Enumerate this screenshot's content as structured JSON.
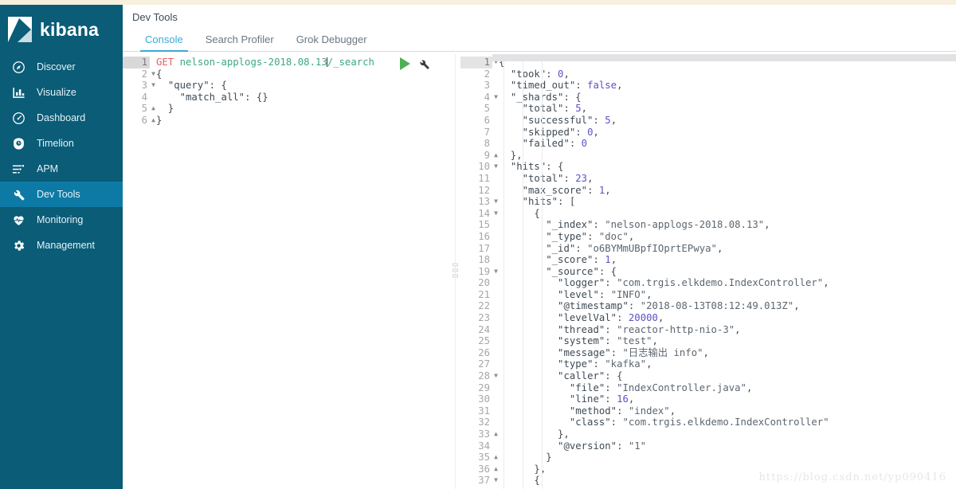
{
  "brand": {
    "name": "kibana"
  },
  "sidebar": {
    "items": [
      {
        "label": "Discover",
        "icon": "compass-icon",
        "active": false
      },
      {
        "label": "Visualize",
        "icon": "bar-chart-icon",
        "active": false
      },
      {
        "label": "Dashboard",
        "icon": "gauge-icon",
        "active": false
      },
      {
        "label": "Timelion",
        "icon": "clock-badge-icon",
        "active": false
      },
      {
        "label": "APM",
        "icon": "apm-lines-icon",
        "active": false
      },
      {
        "label": "Dev Tools",
        "icon": "wrench-icon",
        "active": true
      },
      {
        "label": "Monitoring",
        "icon": "heartbeat-icon",
        "active": false
      },
      {
        "label": "Management",
        "icon": "gear-icon",
        "active": false
      }
    ]
  },
  "header": {
    "title": "Dev Tools"
  },
  "tabs": [
    {
      "label": "Console",
      "active": true
    },
    {
      "label": "Search Profiler",
      "active": false
    },
    {
      "label": "Grok Debugger",
      "active": false
    }
  ],
  "actions": {
    "play_title": "Click to send request",
    "wrench_title": "Open documentation"
  },
  "request": {
    "method": "GET",
    "path": "nelson-applogs-2018.08.13",
    "endpoint": "/_search",
    "lines": [
      {
        "n": 1,
        "fold": "",
        "current": true,
        "tokens": [
          {
            "t": "method",
            "v": "GET"
          },
          {
            "t": "sp",
            "v": " "
          },
          {
            "t": "url",
            "v": "nelson-applogs-2018.08.13"
          },
          {
            "t": "caret",
            "v": ""
          },
          {
            "t": "url",
            "v": "/_search"
          }
        ]
      },
      {
        "n": 2,
        "fold": "open",
        "current": false,
        "tokens": [
          {
            "t": "punct",
            "v": "{"
          }
        ]
      },
      {
        "n": 3,
        "fold": "open",
        "current": false,
        "tokens": [
          {
            "t": "punct",
            "v": "  "
          },
          {
            "t": "key",
            "v": "\"query\""
          },
          {
            "t": "punct",
            "v": ": {"
          }
        ]
      },
      {
        "n": 4,
        "fold": "",
        "current": false,
        "tokens": [
          {
            "t": "punct",
            "v": "    "
          },
          {
            "t": "key",
            "v": "\"match_all\""
          },
          {
            "t": "punct",
            "v": ": {}"
          }
        ]
      },
      {
        "n": 5,
        "fold": "close",
        "current": false,
        "tokens": [
          {
            "t": "punct",
            "v": "  }"
          }
        ]
      },
      {
        "n": 6,
        "fold": "close",
        "current": false,
        "tokens": [
          {
            "t": "punct",
            "v": "}"
          }
        ]
      }
    ]
  },
  "response": {
    "took": 0,
    "timed_out": false,
    "shards": {
      "total": 5,
      "successful": 5,
      "skipped": 0,
      "failed": 0
    },
    "hits_total": 23,
    "max_score": 1,
    "lines": [
      {
        "n": 1,
        "fold": "open",
        "current": true,
        "tokens": [
          {
            "t": "punct",
            "v": "{"
          }
        ]
      },
      {
        "n": 2,
        "fold": "",
        "current": false,
        "tokens": [
          {
            "t": "punct",
            "v": "  "
          },
          {
            "t": "key",
            "v": "\"took\""
          },
          {
            "t": "punct",
            "v": ": "
          },
          {
            "t": "num",
            "v": "0"
          },
          {
            "t": "punct",
            "v": ","
          }
        ]
      },
      {
        "n": 3,
        "fold": "",
        "current": false,
        "tokens": [
          {
            "t": "punct",
            "v": "  "
          },
          {
            "t": "key",
            "v": "\"timed_out\""
          },
          {
            "t": "punct",
            "v": ": "
          },
          {
            "t": "bool",
            "v": "false"
          },
          {
            "t": "punct",
            "v": ","
          }
        ]
      },
      {
        "n": 4,
        "fold": "open",
        "current": false,
        "tokens": [
          {
            "t": "punct",
            "v": "  "
          },
          {
            "t": "key",
            "v": "\"_shards\""
          },
          {
            "t": "punct",
            "v": ": {"
          }
        ]
      },
      {
        "n": 5,
        "fold": "",
        "current": false,
        "tokens": [
          {
            "t": "punct",
            "v": "    "
          },
          {
            "t": "key",
            "v": "\"total\""
          },
          {
            "t": "punct",
            "v": ": "
          },
          {
            "t": "num",
            "v": "5"
          },
          {
            "t": "punct",
            "v": ","
          }
        ]
      },
      {
        "n": 6,
        "fold": "",
        "current": false,
        "tokens": [
          {
            "t": "punct",
            "v": "    "
          },
          {
            "t": "key",
            "v": "\"successful\""
          },
          {
            "t": "punct",
            "v": ": "
          },
          {
            "t": "num",
            "v": "5"
          },
          {
            "t": "punct",
            "v": ","
          }
        ]
      },
      {
        "n": 7,
        "fold": "",
        "current": false,
        "tokens": [
          {
            "t": "punct",
            "v": "    "
          },
          {
            "t": "key",
            "v": "\"skipped\""
          },
          {
            "t": "punct",
            "v": ": "
          },
          {
            "t": "num",
            "v": "0"
          },
          {
            "t": "punct",
            "v": ","
          }
        ]
      },
      {
        "n": 8,
        "fold": "",
        "current": false,
        "tokens": [
          {
            "t": "punct",
            "v": "    "
          },
          {
            "t": "key",
            "v": "\"failed\""
          },
          {
            "t": "punct",
            "v": ": "
          },
          {
            "t": "num",
            "v": "0"
          }
        ]
      },
      {
        "n": 9,
        "fold": "close",
        "current": false,
        "tokens": [
          {
            "t": "punct",
            "v": "  },"
          }
        ]
      },
      {
        "n": 10,
        "fold": "open",
        "current": false,
        "tokens": [
          {
            "t": "punct",
            "v": "  "
          },
          {
            "t": "key",
            "v": "\"hits\""
          },
          {
            "t": "punct",
            "v": ": {"
          }
        ]
      },
      {
        "n": 11,
        "fold": "",
        "current": false,
        "tokens": [
          {
            "t": "punct",
            "v": "    "
          },
          {
            "t": "key",
            "v": "\"total\""
          },
          {
            "t": "punct",
            "v": ": "
          },
          {
            "t": "num",
            "v": "23"
          },
          {
            "t": "punct",
            "v": ","
          }
        ]
      },
      {
        "n": 12,
        "fold": "",
        "current": false,
        "tokens": [
          {
            "t": "punct",
            "v": "    "
          },
          {
            "t": "key",
            "v": "\"max_score\""
          },
          {
            "t": "punct",
            "v": ": "
          },
          {
            "t": "num",
            "v": "1"
          },
          {
            "t": "punct",
            "v": ","
          }
        ]
      },
      {
        "n": 13,
        "fold": "open",
        "current": false,
        "tokens": [
          {
            "t": "punct",
            "v": "    "
          },
          {
            "t": "key",
            "v": "\"hits\""
          },
          {
            "t": "punct",
            "v": ": ["
          }
        ]
      },
      {
        "n": 14,
        "fold": "open",
        "current": false,
        "tokens": [
          {
            "t": "punct",
            "v": "      {"
          }
        ]
      },
      {
        "n": 15,
        "fold": "",
        "current": false,
        "tokens": [
          {
            "t": "punct",
            "v": "        "
          },
          {
            "t": "key",
            "v": "\"_index\""
          },
          {
            "t": "punct",
            "v": ": "
          },
          {
            "t": "str",
            "v": "\"nelson-applogs-2018.08.13\""
          },
          {
            "t": "punct",
            "v": ","
          }
        ]
      },
      {
        "n": 16,
        "fold": "",
        "current": false,
        "tokens": [
          {
            "t": "punct",
            "v": "        "
          },
          {
            "t": "key",
            "v": "\"_type\""
          },
          {
            "t": "punct",
            "v": ": "
          },
          {
            "t": "str",
            "v": "\"doc\""
          },
          {
            "t": "punct",
            "v": ","
          }
        ]
      },
      {
        "n": 17,
        "fold": "",
        "current": false,
        "tokens": [
          {
            "t": "punct",
            "v": "        "
          },
          {
            "t": "key",
            "v": "\"_id\""
          },
          {
            "t": "punct",
            "v": ": "
          },
          {
            "t": "str",
            "v": "\"o6BYMmUBpfIOprtEPwya\""
          },
          {
            "t": "punct",
            "v": ","
          }
        ]
      },
      {
        "n": 18,
        "fold": "",
        "current": false,
        "tokens": [
          {
            "t": "punct",
            "v": "        "
          },
          {
            "t": "key",
            "v": "\"_score\""
          },
          {
            "t": "punct",
            "v": ": "
          },
          {
            "t": "num",
            "v": "1"
          },
          {
            "t": "punct",
            "v": ","
          }
        ]
      },
      {
        "n": 19,
        "fold": "open",
        "current": false,
        "tokens": [
          {
            "t": "punct",
            "v": "        "
          },
          {
            "t": "key",
            "v": "\"_source\""
          },
          {
            "t": "punct",
            "v": ": {"
          }
        ]
      },
      {
        "n": 20,
        "fold": "",
        "current": false,
        "tokens": [
          {
            "t": "punct",
            "v": "          "
          },
          {
            "t": "key",
            "v": "\"logger\""
          },
          {
            "t": "punct",
            "v": ": "
          },
          {
            "t": "str",
            "v": "\"com.trgis.elkdemo.IndexController\""
          },
          {
            "t": "punct",
            "v": ","
          }
        ]
      },
      {
        "n": 21,
        "fold": "",
        "current": false,
        "tokens": [
          {
            "t": "punct",
            "v": "          "
          },
          {
            "t": "key",
            "v": "\"level\""
          },
          {
            "t": "punct",
            "v": ": "
          },
          {
            "t": "str",
            "v": "\"INFO\""
          },
          {
            "t": "punct",
            "v": ","
          }
        ]
      },
      {
        "n": 22,
        "fold": "",
        "current": false,
        "tokens": [
          {
            "t": "punct",
            "v": "          "
          },
          {
            "t": "key",
            "v": "\"@timestamp\""
          },
          {
            "t": "punct",
            "v": ": "
          },
          {
            "t": "str",
            "v": "\"2018-08-13T08:12:49.013Z\""
          },
          {
            "t": "punct",
            "v": ","
          }
        ]
      },
      {
        "n": 23,
        "fold": "",
        "current": false,
        "tokens": [
          {
            "t": "punct",
            "v": "          "
          },
          {
            "t": "key",
            "v": "\"levelVal\""
          },
          {
            "t": "punct",
            "v": ": "
          },
          {
            "t": "num",
            "v": "20000"
          },
          {
            "t": "punct",
            "v": ","
          }
        ]
      },
      {
        "n": 24,
        "fold": "",
        "current": false,
        "tokens": [
          {
            "t": "punct",
            "v": "          "
          },
          {
            "t": "key",
            "v": "\"thread\""
          },
          {
            "t": "punct",
            "v": ": "
          },
          {
            "t": "str",
            "v": "\"reactor-http-nio-3\""
          },
          {
            "t": "punct",
            "v": ","
          }
        ]
      },
      {
        "n": 25,
        "fold": "",
        "current": false,
        "tokens": [
          {
            "t": "punct",
            "v": "          "
          },
          {
            "t": "key",
            "v": "\"system\""
          },
          {
            "t": "punct",
            "v": ": "
          },
          {
            "t": "str",
            "v": "\"test\""
          },
          {
            "t": "punct",
            "v": ","
          }
        ]
      },
      {
        "n": 26,
        "fold": "",
        "current": false,
        "tokens": [
          {
            "t": "punct",
            "v": "          "
          },
          {
            "t": "key",
            "v": "\"message\""
          },
          {
            "t": "punct",
            "v": ": "
          },
          {
            "t": "str",
            "v": "\"日志输出 info\""
          },
          {
            "t": "punct",
            "v": ","
          }
        ]
      },
      {
        "n": 27,
        "fold": "",
        "current": false,
        "tokens": [
          {
            "t": "punct",
            "v": "          "
          },
          {
            "t": "key",
            "v": "\"type\""
          },
          {
            "t": "punct",
            "v": ": "
          },
          {
            "t": "str",
            "v": "\"kafka\""
          },
          {
            "t": "punct",
            "v": ","
          }
        ]
      },
      {
        "n": 28,
        "fold": "open",
        "current": false,
        "tokens": [
          {
            "t": "punct",
            "v": "          "
          },
          {
            "t": "key",
            "v": "\"caller\""
          },
          {
            "t": "punct",
            "v": ": {"
          }
        ]
      },
      {
        "n": 29,
        "fold": "",
        "current": false,
        "tokens": [
          {
            "t": "punct",
            "v": "            "
          },
          {
            "t": "key",
            "v": "\"file\""
          },
          {
            "t": "punct",
            "v": ": "
          },
          {
            "t": "str",
            "v": "\"IndexController.java\""
          },
          {
            "t": "punct",
            "v": ","
          }
        ]
      },
      {
        "n": 30,
        "fold": "",
        "current": false,
        "tokens": [
          {
            "t": "punct",
            "v": "            "
          },
          {
            "t": "key",
            "v": "\"line\""
          },
          {
            "t": "punct",
            "v": ": "
          },
          {
            "t": "num",
            "v": "16"
          },
          {
            "t": "punct",
            "v": ","
          }
        ]
      },
      {
        "n": 31,
        "fold": "",
        "current": false,
        "tokens": [
          {
            "t": "punct",
            "v": "            "
          },
          {
            "t": "key",
            "v": "\"method\""
          },
          {
            "t": "punct",
            "v": ": "
          },
          {
            "t": "str",
            "v": "\"index\""
          },
          {
            "t": "punct",
            "v": ","
          }
        ]
      },
      {
        "n": 32,
        "fold": "",
        "current": false,
        "tokens": [
          {
            "t": "punct",
            "v": "            "
          },
          {
            "t": "key",
            "v": "\"class\""
          },
          {
            "t": "punct",
            "v": ": "
          },
          {
            "t": "str",
            "v": "\"com.trgis.elkdemo.IndexController\""
          }
        ]
      },
      {
        "n": 33,
        "fold": "close",
        "current": false,
        "tokens": [
          {
            "t": "punct",
            "v": "          },"
          }
        ]
      },
      {
        "n": 34,
        "fold": "",
        "current": false,
        "tokens": [
          {
            "t": "punct",
            "v": "          "
          },
          {
            "t": "key",
            "v": "\"@version\""
          },
          {
            "t": "punct",
            "v": ": "
          },
          {
            "t": "str",
            "v": "\"1\""
          }
        ]
      },
      {
        "n": 35,
        "fold": "close",
        "current": false,
        "tokens": [
          {
            "t": "punct",
            "v": "        }"
          }
        ]
      },
      {
        "n": 36,
        "fold": "close",
        "current": false,
        "tokens": [
          {
            "t": "punct",
            "v": "      },"
          }
        ]
      },
      {
        "n": 37,
        "fold": "open",
        "current": false,
        "tokens": [
          {
            "t": "punct",
            "v": "      {"
          }
        ]
      }
    ]
  },
  "watermark": {
    "text": "https://blog.csdn.net/yp090416"
  }
}
